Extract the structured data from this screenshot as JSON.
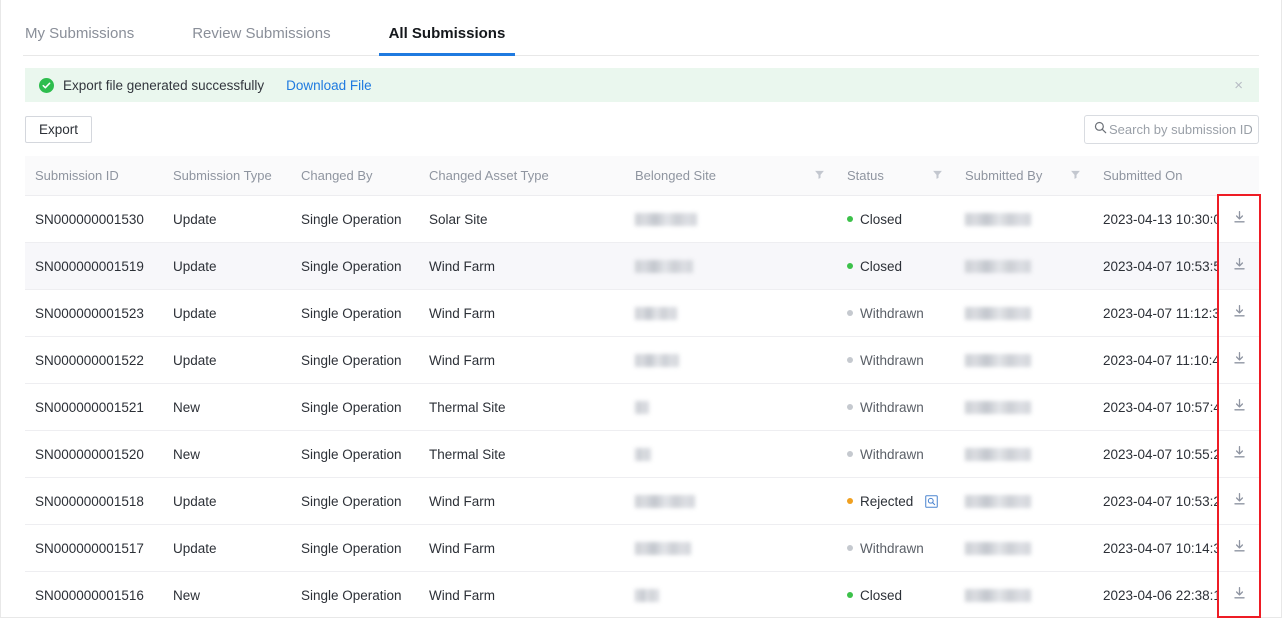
{
  "tabs": [
    {
      "label": "My Submissions",
      "active": false
    },
    {
      "label": "Review Submissions",
      "active": false
    },
    {
      "label": "All Submissions",
      "active": true
    }
  ],
  "alert": {
    "icon": "check-circle-icon",
    "message": "Export file generated successfully",
    "link_label": "Download File",
    "close_label": "×",
    "background_color": "#eaf7ee",
    "icon_color": "#2ebd4e",
    "link_color": "#1f7ae0"
  },
  "toolbar": {
    "export_label": "Export",
    "search_placeholder": "Search by submission ID",
    "search_value": "",
    "search_icon": "search-icon"
  },
  "table": {
    "columns": [
      {
        "key": "submission_id",
        "label": "Submission ID",
        "filter": false
      },
      {
        "key": "submission_type",
        "label": "Submission Type",
        "filter": false
      },
      {
        "key": "changed_by",
        "label": "Changed By",
        "filter": false
      },
      {
        "key": "changed_asset_type",
        "label": "Changed Asset Type",
        "filter": false
      },
      {
        "key": "belonged_site",
        "label": "Belonged Site",
        "filter": true
      },
      {
        "key": "status",
        "label": "Status",
        "filter": true
      },
      {
        "key": "submitted_by",
        "label": "Submitted By",
        "filter": true
      },
      {
        "key": "submitted_on",
        "label": "Submitted On",
        "filter": false
      },
      {
        "key": "actions",
        "label": "",
        "filter": false
      }
    ],
    "rows": [
      {
        "submission_id": "SN000000001530",
        "submission_type": "Update",
        "changed_by": "Single Operation",
        "changed_asset_type": "Solar Site",
        "belonged_site": "",
        "status": "Closed",
        "status_type": "closed",
        "has_audit_icon": false,
        "submitted_by": "",
        "submitted_on": "2023-04-13 10:30:0",
        "download_icon": "download-icon",
        "highlighted": false
      },
      {
        "submission_id": "SN000000001519",
        "submission_type": "Update",
        "changed_by": "Single Operation",
        "changed_asset_type": "Wind Farm",
        "belonged_site": "",
        "status": "Closed",
        "status_type": "closed",
        "has_audit_icon": false,
        "submitted_by": "",
        "submitted_on": "2023-04-07 10:53:5",
        "download_icon": "download-icon",
        "highlighted": true
      },
      {
        "submission_id": "SN000000001523",
        "submission_type": "Update",
        "changed_by": "Single Operation",
        "changed_asset_type": "Wind Farm",
        "belonged_site": "",
        "status": "Withdrawn",
        "status_type": "withdrawn",
        "has_audit_icon": false,
        "submitted_by": "",
        "submitted_on": "2023-04-07 11:12:3",
        "download_icon": "download-icon",
        "highlighted": false
      },
      {
        "submission_id": "SN000000001522",
        "submission_type": "Update",
        "changed_by": "Single Operation",
        "changed_asset_type": "Wind Farm",
        "belonged_site": "",
        "status": "Withdrawn",
        "status_type": "withdrawn",
        "has_audit_icon": false,
        "submitted_by": "",
        "submitted_on": "2023-04-07 11:10:4",
        "download_icon": "download-icon",
        "highlighted": false
      },
      {
        "submission_id": "SN000000001521",
        "submission_type": "New",
        "changed_by": "Single Operation",
        "changed_asset_type": "Thermal Site",
        "belonged_site": "",
        "status": "Withdrawn",
        "status_type": "withdrawn",
        "has_audit_icon": false,
        "submitted_by": "",
        "submitted_on": "2023-04-07 10:57:4",
        "download_icon": "download-icon",
        "highlighted": false
      },
      {
        "submission_id": "SN000000001520",
        "submission_type": "New",
        "changed_by": "Single Operation",
        "changed_asset_type": "Thermal Site",
        "belonged_site": "",
        "status": "Withdrawn",
        "status_type": "withdrawn",
        "has_audit_icon": false,
        "submitted_by": "",
        "submitted_on": "2023-04-07 10:55:2",
        "download_icon": "download-icon",
        "highlighted": false
      },
      {
        "submission_id": "SN000000001518",
        "submission_type": "Update",
        "changed_by": "Single Operation",
        "changed_asset_type": "Wind Farm",
        "belonged_site": "",
        "status": "Rejected",
        "status_type": "rejected",
        "has_audit_icon": true,
        "submitted_by": "",
        "submitted_on": "2023-04-07 10:53:2",
        "download_icon": "download-icon",
        "highlighted": false
      },
      {
        "submission_id": "SN000000001517",
        "submission_type": "Update",
        "changed_by": "Single Operation",
        "changed_asset_type": "Wind Farm",
        "belonged_site": "",
        "status": "Withdrawn",
        "status_type": "withdrawn",
        "has_audit_icon": false,
        "submitted_by": "",
        "submitted_on": "2023-04-07 10:14:3",
        "download_icon": "download-icon",
        "highlighted": false
      },
      {
        "submission_id": "SN000000001516",
        "submission_type": "New",
        "changed_by": "Single Operation",
        "changed_asset_type": "Wind Farm",
        "belonged_site": "",
        "status": "Closed",
        "status_type": "closed",
        "has_audit_icon": false,
        "submitted_by": "",
        "submitted_on": "2023-04-06 22:38:1",
        "download_icon": "download-icon",
        "highlighted": false
      }
    ]
  },
  "annotation": {
    "color": "#ee1c25",
    "target": "download-column"
  },
  "colors": {
    "accent": "#1f7ae0",
    "status_closed": "#3cc14a",
    "status_withdrawn": "#c5c9cf",
    "status_rejected": "#f0a020",
    "header_bg": "#fafafb",
    "row_alt_bg": "#f7f7fa"
  }
}
